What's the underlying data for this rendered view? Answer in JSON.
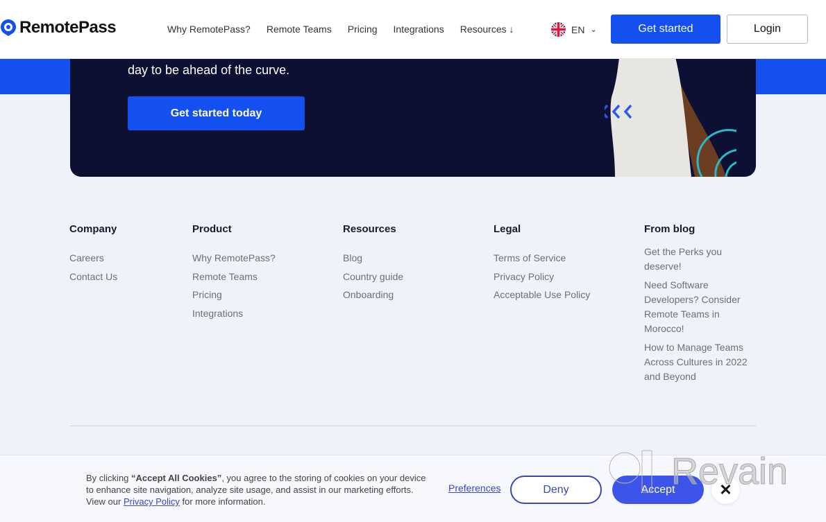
{
  "header": {
    "brand": "RemotePass",
    "nav": [
      "Why RemotePass?",
      "Remote Teams",
      "Pricing",
      "Integrations",
      "Resources"
    ],
    "language": "EN",
    "get_started": "Get started",
    "login": "Login"
  },
  "hero": {
    "text": "day to be ahead of the curve.",
    "cta": "Get started today"
  },
  "footer": {
    "company": {
      "title": "Company",
      "links": [
        "Careers",
        "Contact Us"
      ]
    },
    "product": {
      "title": "Product",
      "links": [
        "Why RemotePass?",
        "Remote Teams",
        "Pricing",
        "Integrations"
      ]
    },
    "resources": {
      "title": "Resources",
      "links": [
        "Blog",
        "Country guide",
        "Onboarding"
      ]
    },
    "legal": {
      "title": "Legal",
      "links": [
        "Terms of Service",
        "Privacy Policy",
        "Acceptable Use Policy"
      ]
    },
    "blog": {
      "title": "From blog",
      "links": [
        "Get the Perks you deserve!",
        "Need Software Developers? Consider Remote Teams in Morocco!",
        "How to Manage Teams Across Cultures in 2022 and Beyond"
      ]
    }
  },
  "cookie": {
    "prefix": "By clicking ",
    "bold": "“Accept All Cookies”",
    "middle": ", you agree to the storing of cookies on your device to enhance site navigation, analyze site usage, and assist in our marketing efforts. View our ",
    "policy": "Privacy Policy",
    "suffix": " for more information.",
    "preferences": "Preferences",
    "deny": "Deny",
    "accept": "Accept",
    "close": "✕"
  },
  "watermark": "Revain",
  "colors": {
    "primary": "#1450ef",
    "card": "#0d0f33",
    "accent": "#3c55e8"
  }
}
